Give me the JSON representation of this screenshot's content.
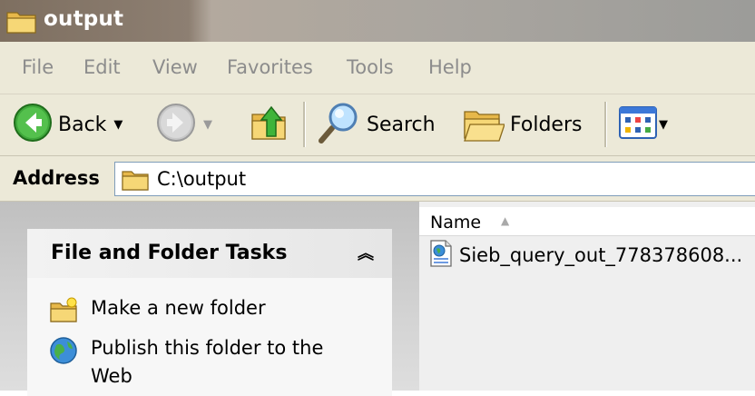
{
  "window": {
    "title": "output"
  },
  "menu": [
    "File",
    "Edit",
    "View",
    "Favorites",
    "Tools",
    "Help"
  ],
  "toolbar": {
    "back_label": "Back",
    "search_label": "Search",
    "folders_label": "Folders"
  },
  "address": {
    "label": "Address",
    "path": "C:\\output"
  },
  "tasks": {
    "title": "File and Folder Tasks",
    "items": [
      {
        "label": "Make a new folder",
        "icon": "new-folder-icon"
      },
      {
        "label": "Publish this folder to the Web",
        "icon": "globe-icon"
      }
    ]
  },
  "files": {
    "column_name": "Name",
    "items": [
      {
        "name": "Sieb_query_out_778378608...",
        "icon": "web-document-icon"
      }
    ]
  },
  "colors": {
    "menu_text": "#8c8c8c",
    "bar_bg": "#ece9d8",
    "address_border": "#7f9db9"
  }
}
